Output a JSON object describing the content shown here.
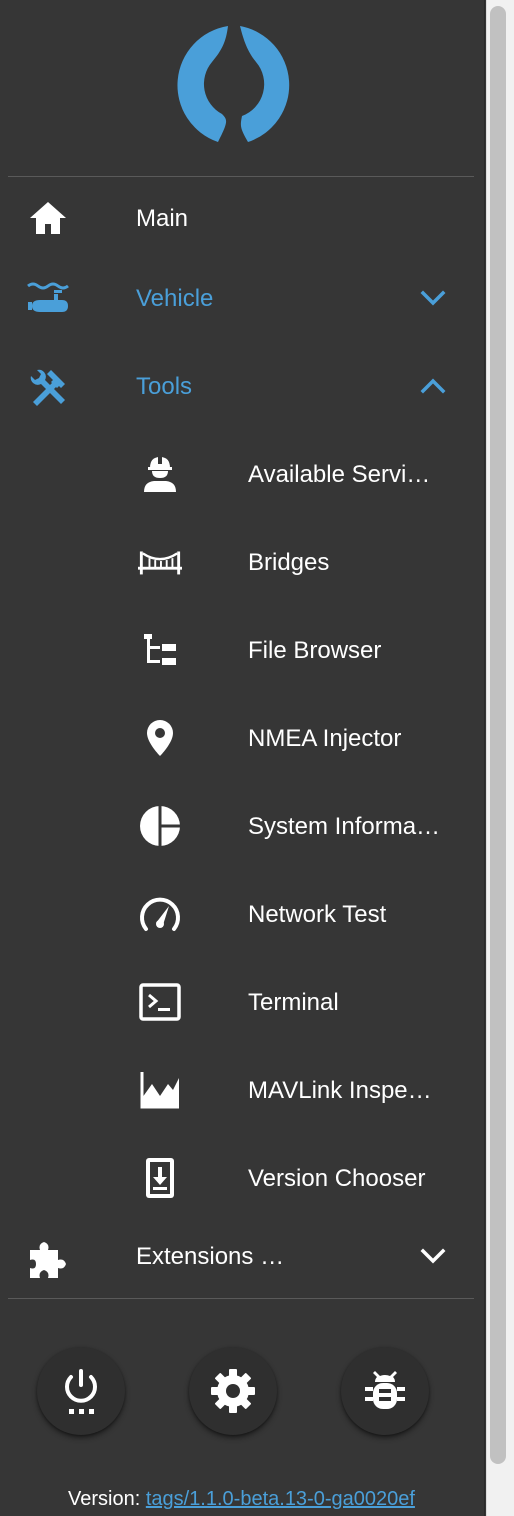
{
  "nav": {
    "main": {
      "label": "Main",
      "icon": "home-icon"
    },
    "vehicle": {
      "label": "Vehicle",
      "icon": "submarine-icon",
      "expanded": false
    },
    "tools": {
      "label": "Tools",
      "icon": "tools-icon",
      "expanded": true,
      "items": [
        {
          "label": "Available Servi…",
          "icon": "worker-icon"
        },
        {
          "label": "Bridges",
          "icon": "bridge-icon"
        },
        {
          "label": "File Browser",
          "icon": "file-tree-icon"
        },
        {
          "label": "NMEA Injector",
          "icon": "map-marker-icon"
        },
        {
          "label": "System Informa…",
          "icon": "pie-chart-icon"
        },
        {
          "label": "Network Test",
          "icon": "speedometer-icon"
        },
        {
          "label": "Terminal",
          "icon": "terminal-icon"
        },
        {
          "label": "MAVLink Inspe…",
          "icon": "chart-line-icon"
        },
        {
          "label": "Version Chooser",
          "icon": "cellphone-arrow-down-icon"
        }
      ]
    },
    "extensions": {
      "label": "Extensions …",
      "icon": "puzzle-icon",
      "expanded": false
    }
  },
  "footer": {
    "buttons": [
      {
        "name": "power",
        "icon": "power-icon"
      },
      {
        "name": "settings",
        "icon": "gear-icon"
      },
      {
        "name": "debug",
        "icon": "bug-icon"
      }
    ],
    "version_prefix": "Version:",
    "version_link": "tags/1.1.0-beta.13-0-ga0020ef"
  },
  "colors": {
    "background": "#363636",
    "accent": "#4a9fd9",
    "text": "#ffffff"
  }
}
